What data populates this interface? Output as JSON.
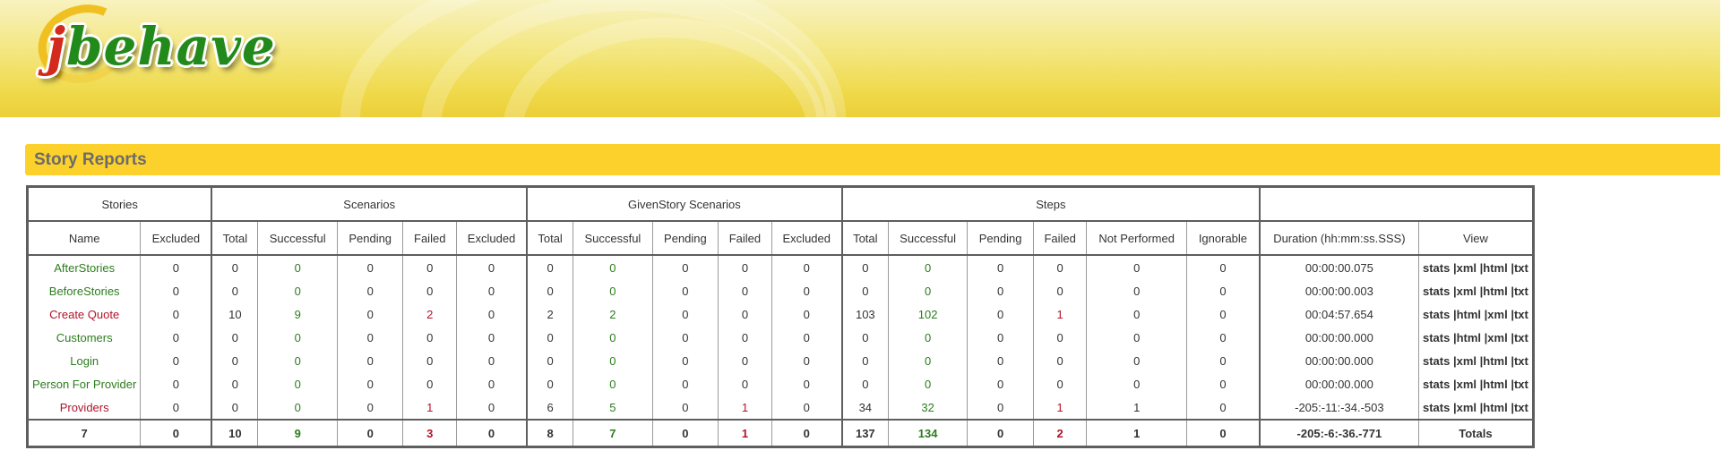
{
  "header": {
    "logo_text": "jbehave"
  },
  "section": {
    "title": "Story Reports"
  },
  "colors": {
    "banner": "#f2e06a",
    "section_bar": "#fdd12c",
    "success": "#2c7d1d",
    "failure": "#b0142a",
    "border": "#5e5e5e"
  },
  "table": {
    "groups": {
      "stories": "Stories",
      "scenarios": "Scenarios",
      "given_story_scenarios": "GivenStory Scenarios",
      "steps": "Steps",
      "blank": ""
    },
    "columns": {
      "name": "Name",
      "excluded": "Excluded",
      "sc_total": "Total",
      "sc_successful": "Successful",
      "sc_pending": "Pending",
      "sc_failed": "Failed",
      "sc_excluded": "Excluded",
      "gs_total": "Total",
      "gs_successful": "Successful",
      "gs_pending": "Pending",
      "gs_failed": "Failed",
      "gs_excluded": "Excluded",
      "st_total": "Total",
      "st_successful": "Successful",
      "st_pending": "Pending",
      "st_failed": "Failed",
      "st_not_performed": "Not Performed",
      "st_ignorable": "Ignorable",
      "duration": "Duration (hh:mm:ss.SSS)",
      "view": "View"
    },
    "view_links": {
      "stats": "stats",
      "xml": "|xml",
      "html": "|html",
      "txt": "|txt"
    },
    "rows": [
      {
        "name": "AfterStories",
        "status": "ok",
        "excluded": "0",
        "sc": [
          "0",
          "0",
          "0",
          "0",
          "0"
        ],
        "gs": [
          "0",
          "0",
          "0",
          "0",
          "0"
        ],
        "st": [
          "0",
          "0",
          "0",
          "0",
          "0",
          "0"
        ],
        "duration": "00:00:00.075",
        "view_order": [
          "stats",
          "xml",
          "html",
          "txt"
        ]
      },
      {
        "name": "BeforeStories",
        "status": "ok",
        "excluded": "0",
        "sc": [
          "0",
          "0",
          "0",
          "0",
          "0"
        ],
        "gs": [
          "0",
          "0",
          "0",
          "0",
          "0"
        ],
        "st": [
          "0",
          "0",
          "0",
          "0",
          "0",
          "0"
        ],
        "duration": "00:00:00.003",
        "view_order": [
          "stats",
          "xml",
          "html",
          "txt"
        ]
      },
      {
        "name": "Create Quote",
        "status": "bad",
        "excluded": "0",
        "sc": [
          "10",
          "9",
          "0",
          "2",
          "0"
        ],
        "gs": [
          "2",
          "2",
          "0",
          "0",
          "0"
        ],
        "st": [
          "103",
          "102",
          "0",
          "1",
          "0",
          "0"
        ],
        "duration": "00:04:57.654",
        "view_order": [
          "stats",
          "html",
          "xml",
          "txt"
        ]
      },
      {
        "name": "Customers",
        "status": "ok",
        "excluded": "0",
        "sc": [
          "0",
          "0",
          "0",
          "0",
          "0"
        ],
        "gs": [
          "0",
          "0",
          "0",
          "0",
          "0"
        ],
        "st": [
          "0",
          "0",
          "0",
          "0",
          "0",
          "0"
        ],
        "duration": "00:00:00.000",
        "view_order": [
          "stats",
          "html",
          "xml",
          "txt"
        ]
      },
      {
        "name": "Login",
        "status": "ok",
        "excluded": "0",
        "sc": [
          "0",
          "0",
          "0",
          "0",
          "0"
        ],
        "gs": [
          "0",
          "0",
          "0",
          "0",
          "0"
        ],
        "st": [
          "0",
          "0",
          "0",
          "0",
          "0",
          "0"
        ],
        "duration": "00:00:00.000",
        "view_order": [
          "stats",
          "xml",
          "html",
          "txt"
        ]
      },
      {
        "name": "Person For Provider",
        "status": "ok",
        "excluded": "0",
        "sc": [
          "0",
          "0",
          "0",
          "0",
          "0"
        ],
        "gs": [
          "0",
          "0",
          "0",
          "0",
          "0"
        ],
        "st": [
          "0",
          "0",
          "0",
          "0",
          "0",
          "0"
        ],
        "duration": "00:00:00.000",
        "view_order": [
          "stats",
          "xml",
          "html",
          "txt"
        ]
      },
      {
        "name": "Providers",
        "status": "bad",
        "excluded": "0",
        "sc": [
          "0",
          "0",
          "0",
          "1",
          "0"
        ],
        "gs": [
          "6",
          "5",
          "0",
          "1",
          "0"
        ],
        "st": [
          "34",
          "32",
          "0",
          "1",
          "1",
          "0"
        ],
        "duration": "-205:-11:-34.-503",
        "view_order": [
          "stats",
          "xml",
          "html",
          "txt"
        ]
      }
    ],
    "totals": {
      "name": "7",
      "excluded": "0",
      "sc": [
        "10",
        "9",
        "0",
        "3",
        "0"
      ],
      "gs": [
        "8",
        "7",
        "0",
        "1",
        "0"
      ],
      "st": [
        "137",
        "134",
        "0",
        "2",
        "1",
        "0"
      ],
      "duration": "-205:-6:-36.-771",
      "label": "Totals"
    }
  }
}
